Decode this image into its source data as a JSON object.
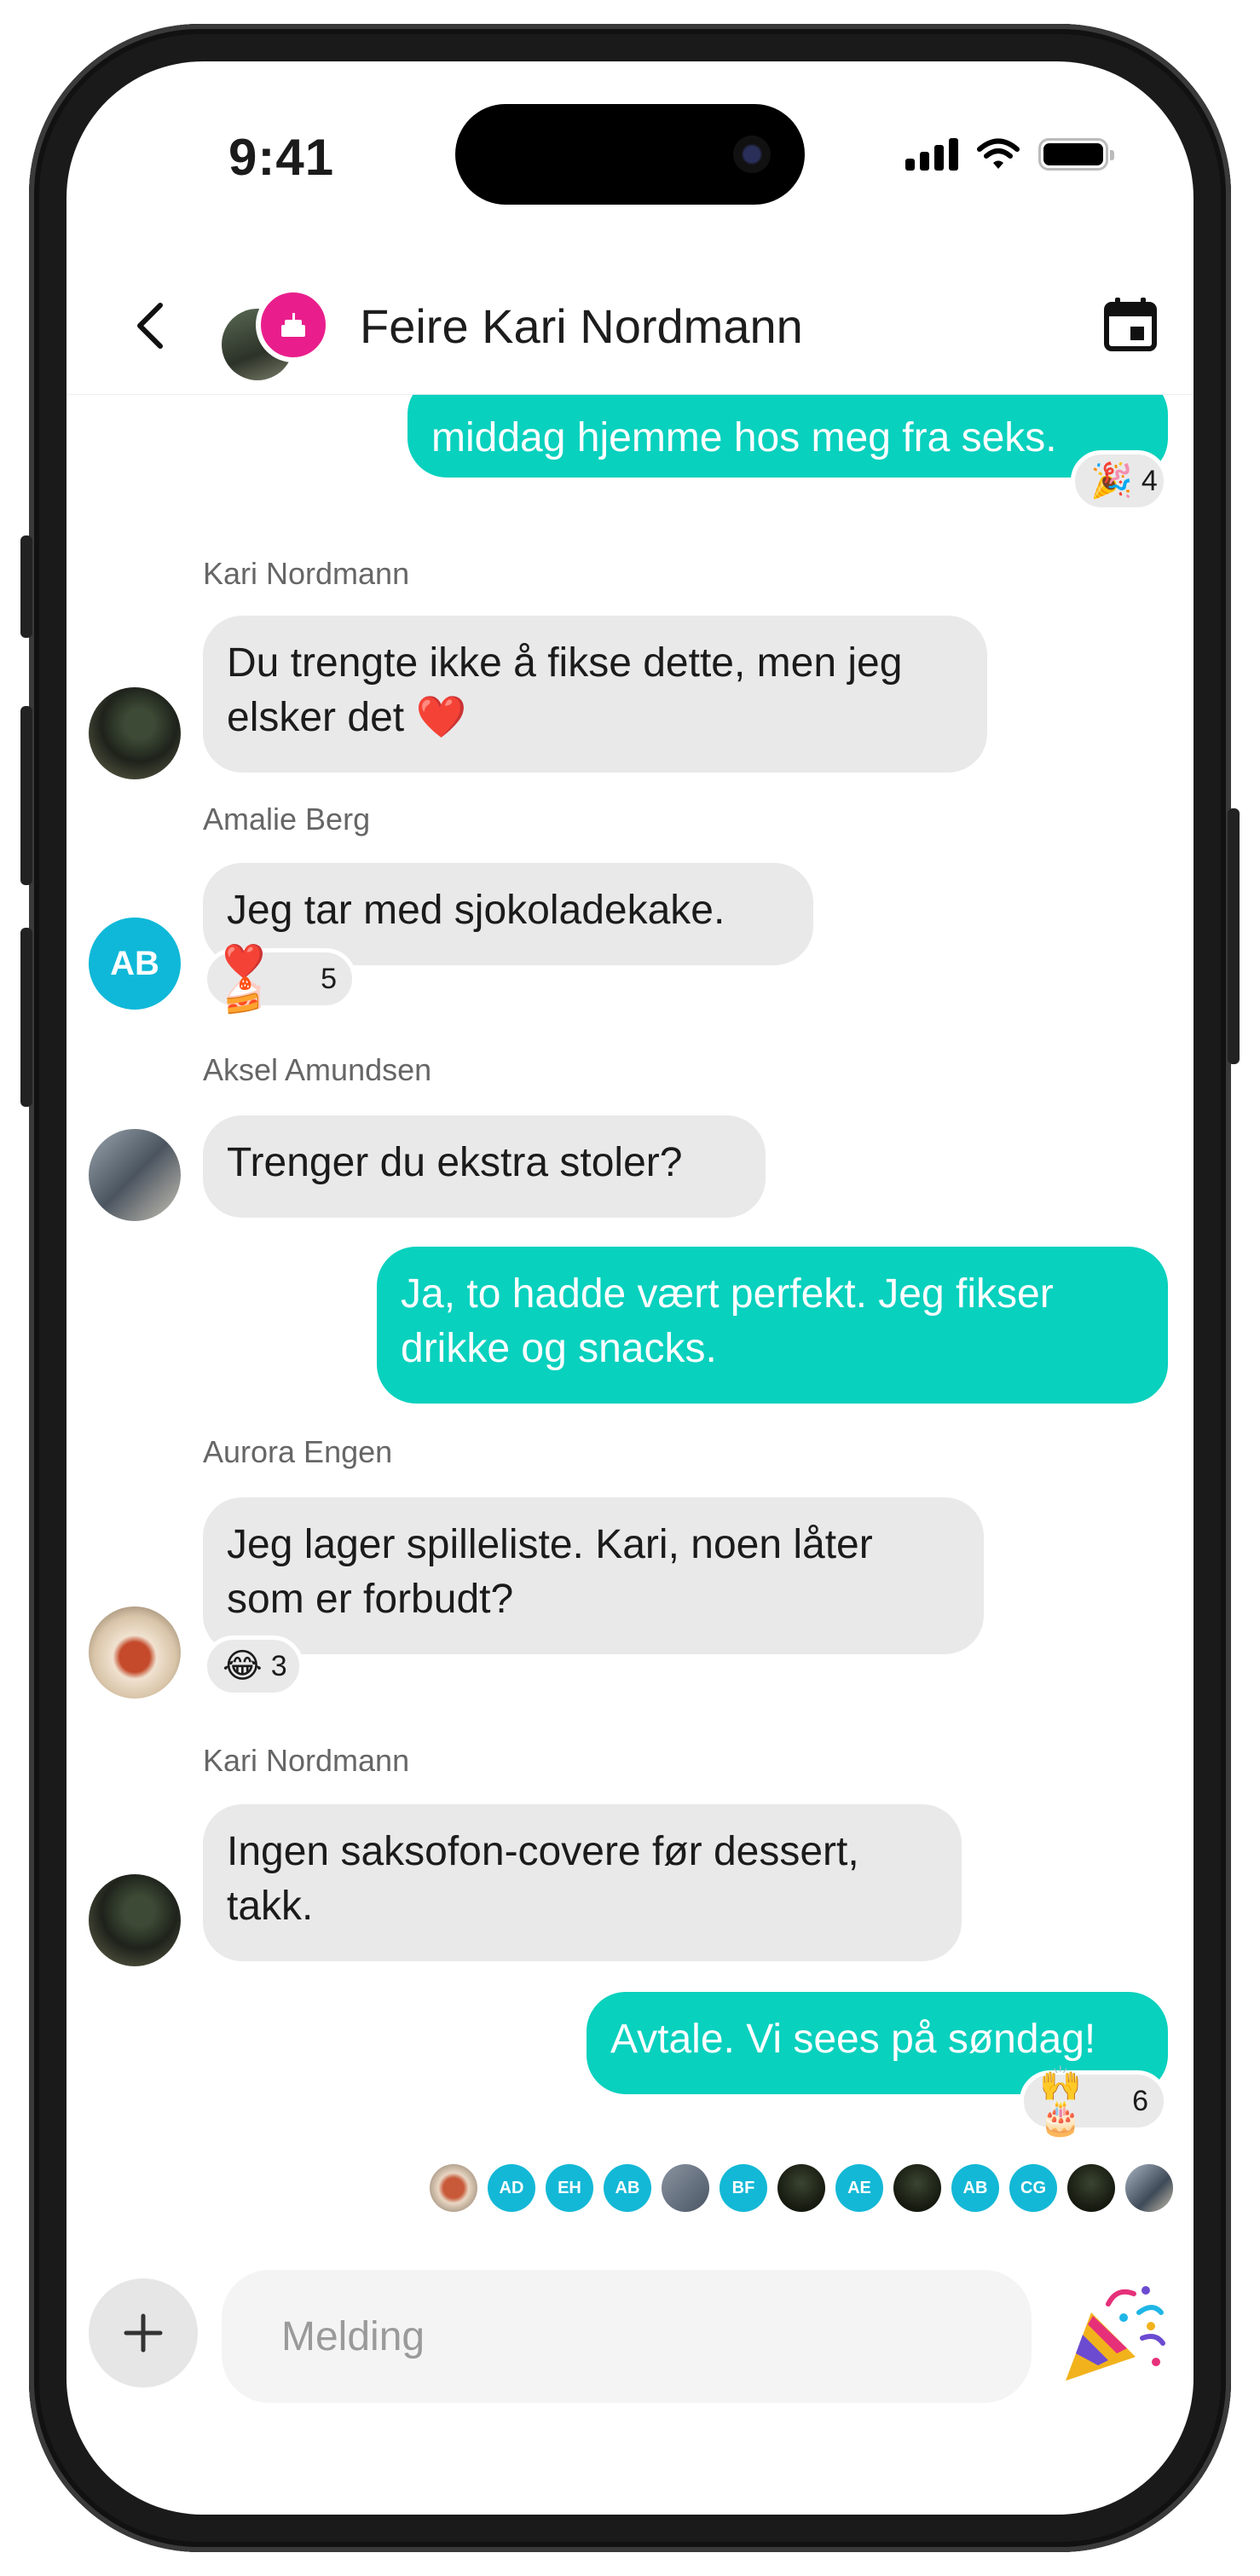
{
  "status_bar": {
    "time": "9:41"
  },
  "header": {
    "title": "Feire Kari Nordmann"
  },
  "messages": [
    {
      "text": "middag hjemme hos meg fra seks.",
      "reaction_emojis": "🎉",
      "reaction_count": "4"
    },
    {
      "sender": "Kari Nordmann",
      "text": "Du trengte ikke å fikse dette, men jeg elsker det ❤️"
    },
    {
      "sender": "Amalie Berg",
      "initials": "AB",
      "text": "Jeg tar med sjokoladekake.",
      "reaction_emojis": "❤️ 🍰",
      "reaction_count": "5"
    },
    {
      "sender": "Aksel Amundsen",
      "text": "Trenger du ekstra stoler?"
    },
    {
      "text": "Ja, to hadde vært perfekt. Jeg fikser drikke og snacks."
    },
    {
      "sender": "Aurora Engen",
      "text": "Jeg lager spilleliste. Kari, noen låter som er forbudt?",
      "reaction_emojis": "😂",
      "reaction_count": "3"
    },
    {
      "sender": "Kari Nordmann",
      "text": "Ingen saksofon-covere før dessert, takk."
    },
    {
      "text": "Avtale. Vi sees på søndag!",
      "reaction_emojis": "🙌 🎂",
      "reaction_count": "6"
    }
  ],
  "read_receipts": [
    "AD",
    "EH",
    "AB",
    "BF",
    "AE",
    "AB",
    "CG"
  ],
  "composer": {
    "placeholder": "Melding"
  },
  "colors": {
    "outgoing": "#08d1be",
    "incoming": "#e9e9ea",
    "badge": "#e91e8c",
    "receipt": "#13b8d6"
  }
}
